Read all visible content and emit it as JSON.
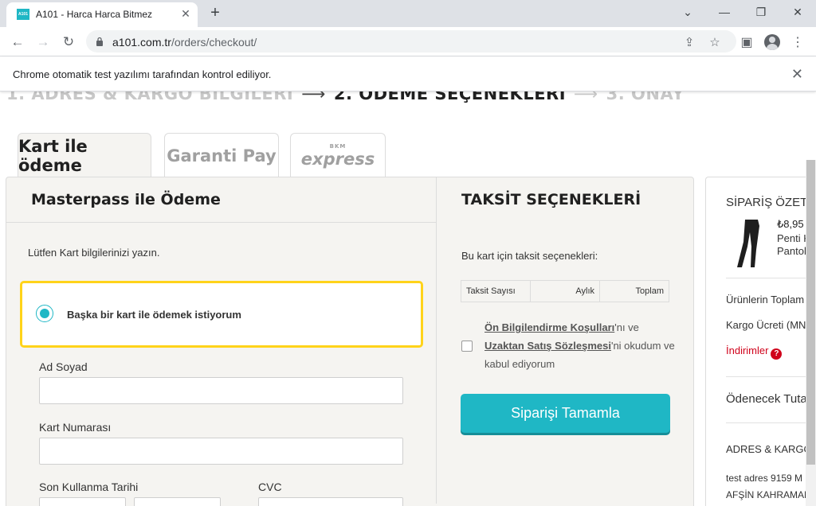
{
  "browser": {
    "tab_title": "A101 - Harca Harca Bitmez",
    "favicon_text": "A101",
    "url_host": "a101.com.tr",
    "url_path": "/orders/checkout/",
    "infobar_text": "Chrome otomatik test yazılımı tarafından kontrol ediliyor."
  },
  "steps": {
    "step1": "1. ADRES & KARGO BİLGİLERİ",
    "step2": "2. ÖDEME SEÇENEKLERİ",
    "step3": "3. ONAY",
    "arrow": "⟶"
  },
  "payment_tabs": {
    "card": "Kart ile ödeme",
    "garanti": "Garanti Pay",
    "bkm_small": "BKM",
    "bkm_big": "express"
  },
  "left": {
    "title": "Masterpass ile Ödeme",
    "prompt": "Lütfen Kart bilgilerinizi yazın.",
    "radio_label": "Başka bir kart ile ödemek istiyorum",
    "name_label": "Ad Soyad",
    "name_value": "",
    "card_label": "Kart Numarası",
    "card_value": "",
    "expiry_label": "Son Kullanma Tarihi",
    "cvc_label": "CVC"
  },
  "installment": {
    "title": "TAKSİT SEÇENEKLERİ",
    "text": "Bu kart için taksit seçenekleri:",
    "col_count": "Taksit Sayısı",
    "col_monthly": "Aylık",
    "col_total": "Toplam"
  },
  "agreement": {
    "link1": "Ön Bilgilendirme Koşulları",
    "text1": "'nı ve",
    "link2": "Uzaktan Satış Sözleşmesi",
    "text2": "'ni okudum ve kabul ediyorum"
  },
  "submit_label": "Siparişi Tamamla",
  "summary": {
    "title": "SİPARİŞ ÖZETİ",
    "product_price": "₺8,95",
    "product_name_1": "Penti K",
    "product_name_2": "Pantol",
    "products_total_label": "Ürünlerin Toplam",
    "shipping_label": "Kargo Ücreti (MN",
    "discounts_label": "İndirimler",
    "payable_label": "Ödenecek Tuta",
    "address_title": "ADRES & KARGO",
    "address_line1": "test adres 9159 M",
    "address_line2": "AFŞİN KAHRAMAN"
  },
  "colors": {
    "brand_teal": "#1fb7c5",
    "highlight_yellow": "#ffd31a",
    "discount_red": "#d0021b"
  }
}
